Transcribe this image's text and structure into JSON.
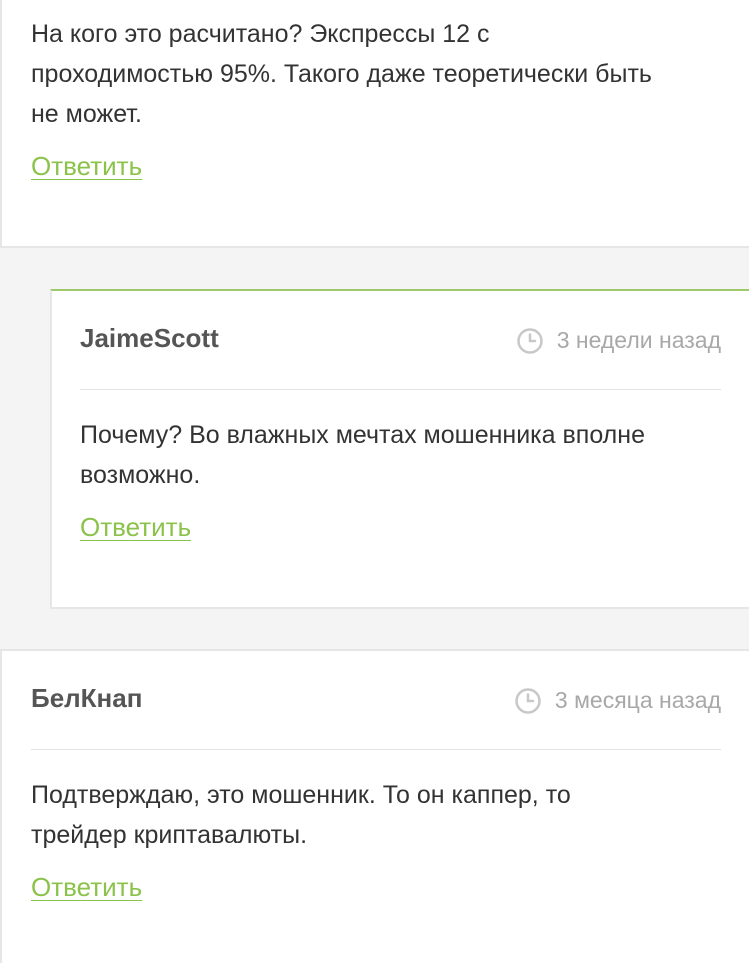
{
  "comments": [
    {
      "text_lines": [
        "На кого это расчитано? Экспрессы 12 с",
        "проходимостью 95%. Такого даже теоретически быть",
        "не может."
      ],
      "reply_label": "Ответить"
    },
    {
      "author": "JaimeScott",
      "time": "3 недели назад",
      "time_icon": "clock-icon",
      "text_lines": [
        "Почему? Во влажных мечтах мошенника вполне",
        "возможно."
      ],
      "reply_label": "Ответить",
      "accent_color": "#9dc86b"
    },
    {
      "author": "БелКнап",
      "time": "3 месяца назад",
      "time_icon": "clock-icon",
      "text_lines": [
        "Подтверждаю, это мошенник. То он каппер, то",
        "трейдер криптавалюты."
      ],
      "reply_label": "Ответить"
    }
  ],
  "colors": {
    "link": "#8bc34a",
    "background": "#f4f4f4",
    "card": "#ffffff"
  }
}
